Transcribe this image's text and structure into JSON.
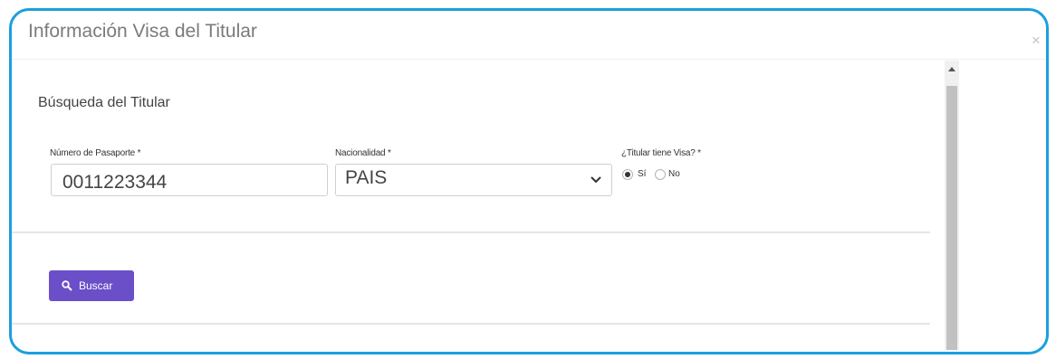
{
  "modal": {
    "title": "Información Visa del Titular",
    "close_label": "×"
  },
  "section": {
    "title": "Búsqueda del Titular"
  },
  "form": {
    "passport": {
      "label": "Número de Pasaporte *",
      "value": "0011223344"
    },
    "nationality": {
      "label": "Nacionalidad *",
      "selected": "PAIS"
    },
    "has_visa": {
      "label": "¿Titular tiene Visa? *",
      "options": [
        {
          "label": "Sí",
          "checked": true
        },
        {
          "label": "No",
          "checked": false
        }
      ]
    }
  },
  "actions": {
    "search_label": "Buscar"
  },
  "colors": {
    "border_accent": "#1aa0dd",
    "primary_button": "#6a4fc8"
  },
  "icons": {
    "close": "close-icon",
    "search": "search-icon",
    "chevron": "chevron-down-icon",
    "scroll_up": "scroll-up-arrow-icon"
  }
}
